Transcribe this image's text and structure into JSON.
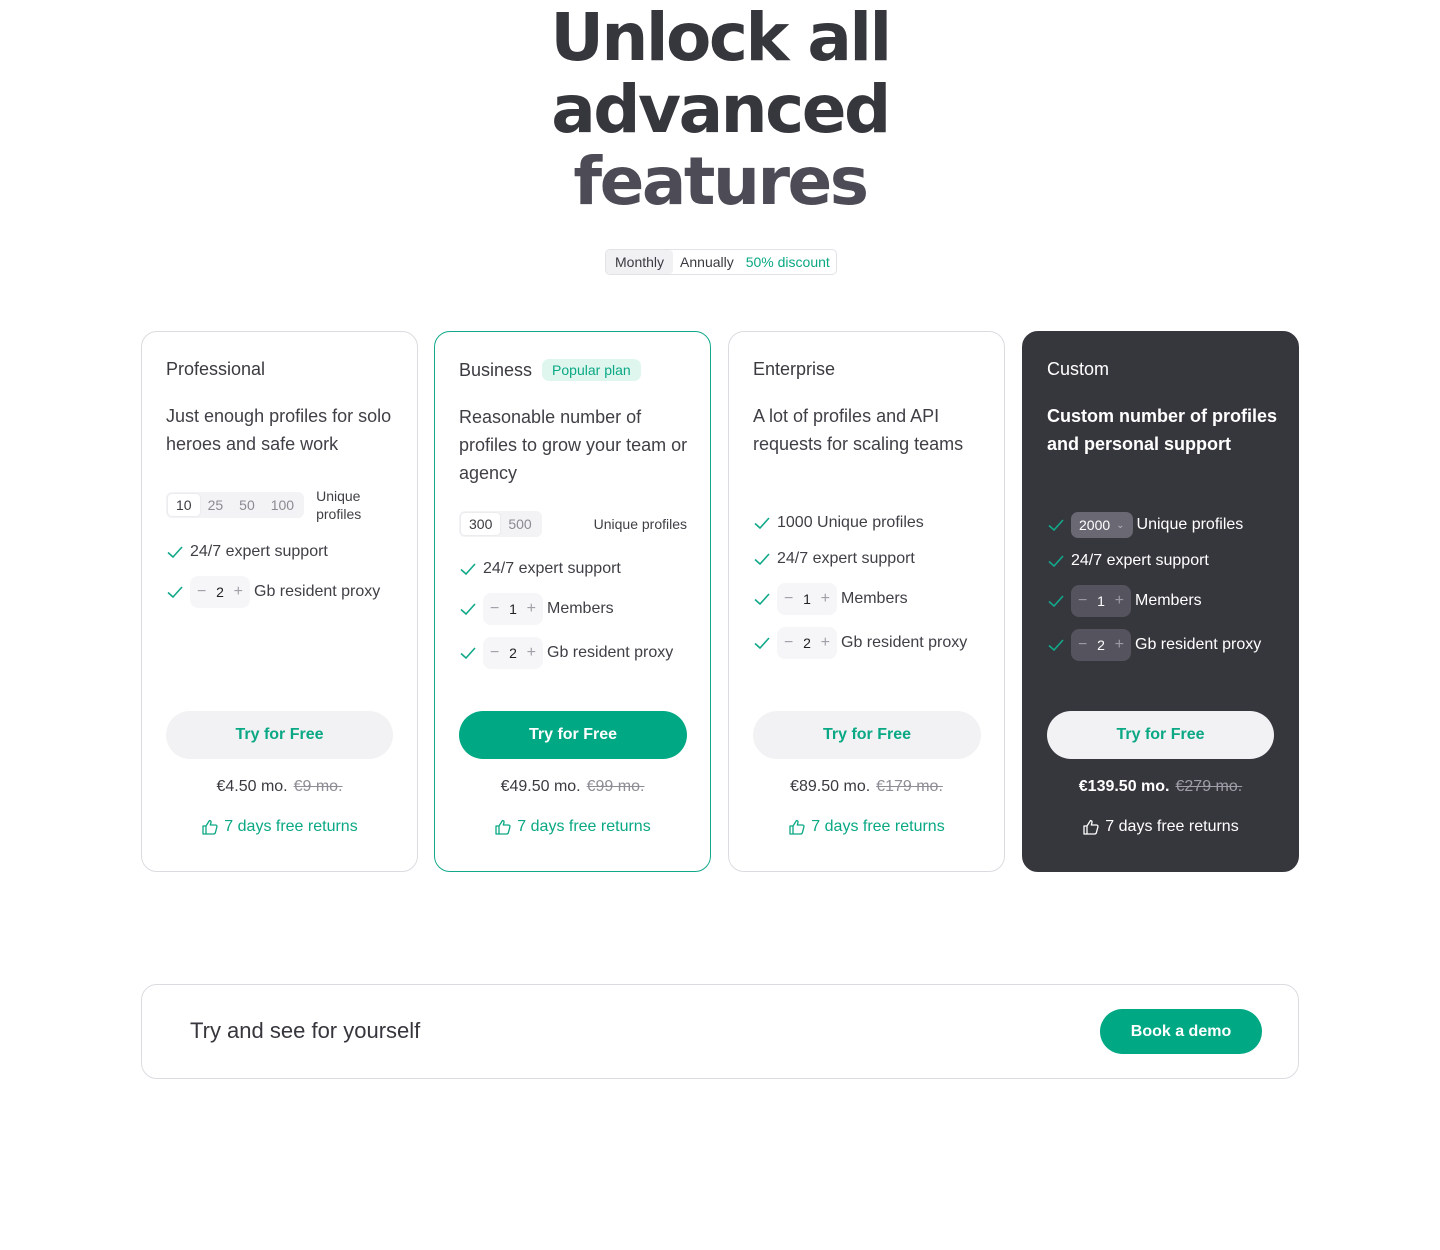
{
  "hero": {
    "title_line1": "Unlock all",
    "title_line2": "advanced",
    "title_line3": "features"
  },
  "billing": {
    "monthly": "Monthly",
    "annually": "Annually",
    "discount": "50% discount",
    "selected": "Monthly"
  },
  "colors": {
    "accent": "#00a884",
    "dark_card": "#36363d"
  },
  "plans": [
    {
      "name": "Professional",
      "description": "Just enough profiles for solo heroes and safe work",
      "profile_options": [
        "10",
        "25",
        "50",
        "100"
      ],
      "profile_selected": "10",
      "profiles_label": "Unique profiles",
      "support": "24/7 expert support",
      "proxy_value": "2",
      "proxy_label": "Gb resident proxy",
      "cta": "Try for Free",
      "price": "€4.50 mo.",
      "old_price": "€9 mo.",
      "returns": "7 days free returns"
    },
    {
      "name": "Business",
      "badge": "Popular plan",
      "description": "Reasonable number of profiles to grow your team or agency",
      "profile_options": [
        "300",
        "500"
      ],
      "profile_selected": "300",
      "profiles_label": "Unique profiles",
      "support": "24/7 expert support",
      "members_value": "1",
      "members_label": "Members",
      "proxy_value": "2",
      "proxy_label": "Gb resident proxy",
      "cta": "Try for Free",
      "price": "€49.50 mo.",
      "old_price": "€99 mo.",
      "returns": "7 days free returns"
    },
    {
      "name": "Enterprise",
      "description": "A lot of profiles and API requests for scaling teams",
      "profiles_text": "1000 Unique profiles",
      "support": "24/7 expert support",
      "members_value": "1",
      "members_label": "Members",
      "proxy_value": "2",
      "proxy_label": "Gb resident proxy",
      "cta": "Try for Free",
      "price": "€89.50 mo.",
      "old_price": "€179 mo.",
      "returns": "7 days free returns"
    },
    {
      "name": "Custom",
      "description": "Custom number of profiles and personal support",
      "profile_select_value": "2000",
      "profiles_label": "Unique profiles",
      "support": "24/7 expert support",
      "members_value": "1",
      "members_label": "Members",
      "proxy_value": "2",
      "proxy_label": "Gb resident proxy",
      "cta": "Try for Free",
      "price": "€139.50 mo.",
      "old_price": "€279 mo.",
      "returns": "7 days free returns"
    }
  ],
  "demo": {
    "title": "Try and see for yourself",
    "button": "Book a demo"
  }
}
